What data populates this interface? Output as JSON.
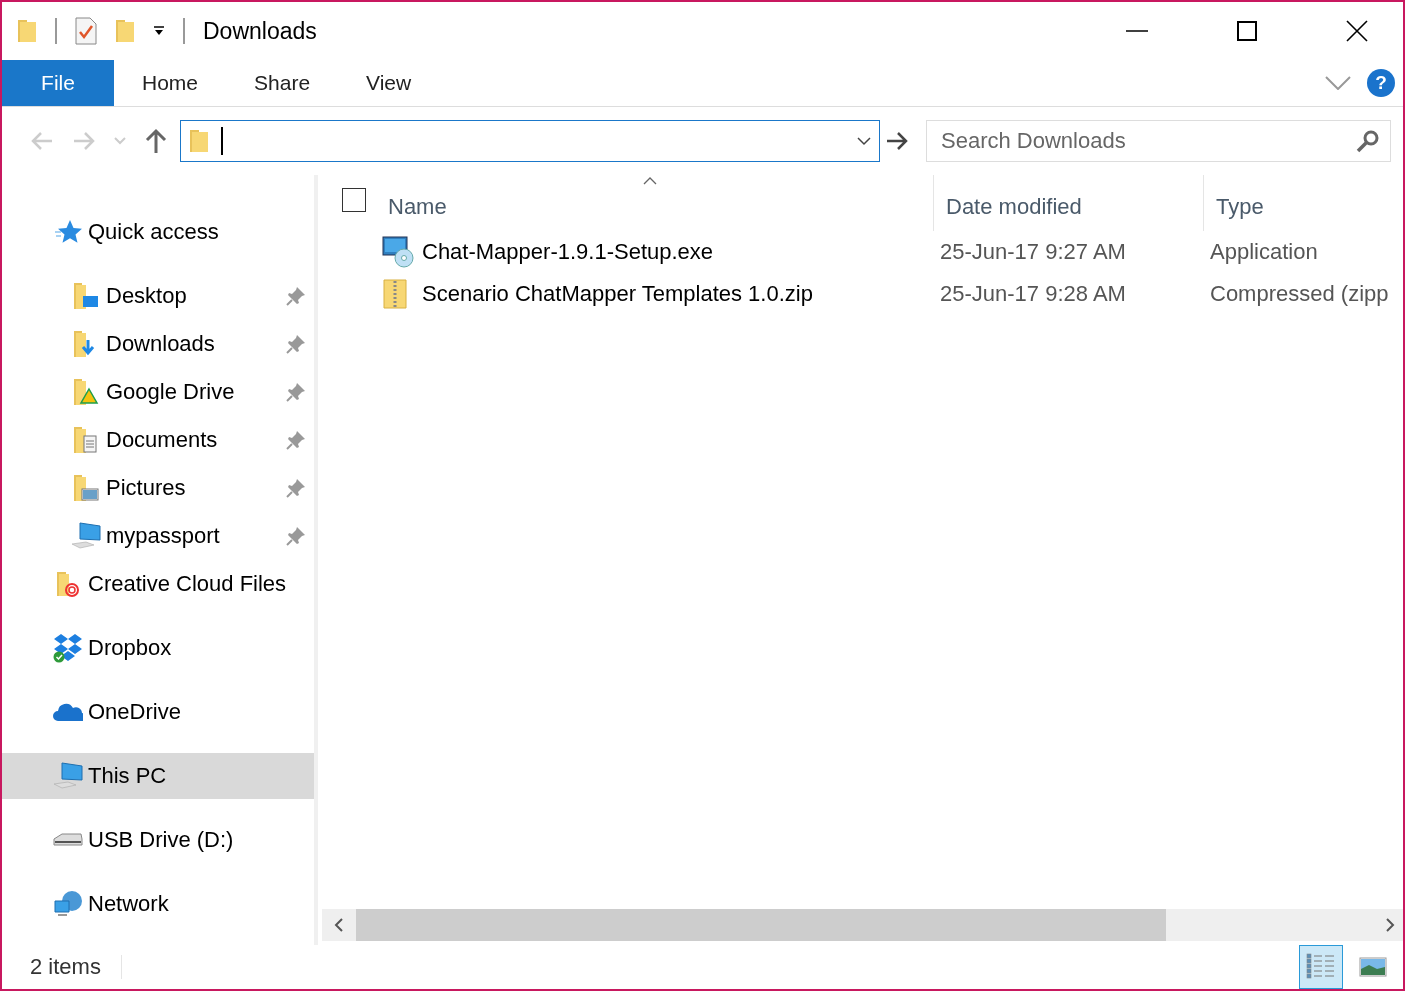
{
  "window": {
    "title": "Downloads"
  },
  "ribbon": {
    "file_label": "File",
    "help_label": "?",
    "tabs": [
      {
        "label": "Home",
        "selected": false
      },
      {
        "label": "Share",
        "selected": false
      },
      {
        "label": "View",
        "selected": false
      }
    ]
  },
  "search": {
    "placeholder": "Search Downloads"
  },
  "sidebar": {
    "items": [
      {
        "label": "Quick access",
        "kind": "star",
        "selected": false,
        "children": [
          {
            "label": "Desktop",
            "kind": "desktop",
            "pinned": true,
            "selected": false
          },
          {
            "label": "Downloads",
            "kind": "downloads",
            "pinned": true,
            "selected": false
          },
          {
            "label": "Google Drive",
            "kind": "gdrive",
            "pinned": true,
            "selected": false
          },
          {
            "label": "Documents",
            "kind": "documents",
            "pinned": true,
            "selected": false
          },
          {
            "label": "Pictures",
            "kind": "pictures",
            "pinned": true,
            "selected": false
          },
          {
            "label": "mypassport",
            "kind": "computer",
            "pinned": true,
            "selected": false
          }
        ]
      },
      {
        "label": "Creative Cloud Files",
        "kind": "creative-cloud",
        "selected": false
      },
      {
        "label": "Dropbox",
        "kind": "dropbox",
        "selected": false
      },
      {
        "label": "OneDrive",
        "kind": "onedrive",
        "selected": false
      },
      {
        "label": "This PC",
        "kind": "computer",
        "selected": true
      },
      {
        "label": "USB Drive (D:)",
        "kind": "drive",
        "selected": false
      },
      {
        "label": "Network",
        "kind": "network",
        "selected": false
      }
    ]
  },
  "table": {
    "select_all_checked": false,
    "columns": [
      {
        "label": "Name",
        "sorted": true
      },
      {
        "label": "Date modified",
        "sorted": false
      },
      {
        "label": "Type",
        "sorted": false
      }
    ],
    "rows": [
      {
        "kind": "exe",
        "name": "Chat-Mapper-1.9.1-Setup.exe",
        "date": "25-Jun-17 9:27 AM",
        "type": "Application"
      },
      {
        "kind": "zip",
        "name": "Scenario ChatMapper Templates 1.0.zip",
        "date": "25-Jun-17 9:28 AM",
        "type": "Compressed (zipp"
      }
    ]
  },
  "status_bar": {
    "text": "2 items",
    "views": [
      {
        "kind": "details",
        "selected": true
      },
      {
        "kind": "large-icons",
        "selected": false
      }
    ]
  }
}
